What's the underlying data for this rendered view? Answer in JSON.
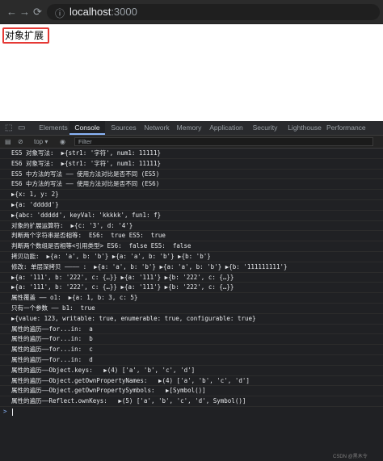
{
  "browser": {
    "back_icon": "←",
    "forward_icon": "→",
    "reload_icon": "⟳",
    "info_icon": "ⓘ",
    "url_host": "localhost",
    "url_port": ":3000"
  },
  "page": {
    "title": "对象扩展"
  },
  "devtools": {
    "tabs": [
      "Elements",
      "Console",
      "Sources",
      "Network",
      "Memory",
      "Application",
      "Security",
      "Lighthouse",
      "Performance"
    ],
    "active_tab": "Console",
    "context": "top ▾",
    "filter_placeholder": "Filter"
  },
  "console_lines": [
    "ES5 对象写法:  ▶{str1: '字符', num1: 11111}",
    "ES6 对象写法:  ▶{str1: '字符', num1: 11111}",
    "ES5 中方法的写法 —— 使用方法对比是否不同 (ES5)",
    "ES6 中方法的写法 —— 使用方法对比是否不同 (ES6)",
    "▶{x: 1, y: 2}",
    "▶{a: 'ddddd'}",
    "▶{abc: 'ddddd', keyVal: 'kkkkk', fun1: f}",
    "对象的扩展运算符:  ▶{c: '3', d: '4'}",
    "判断两个字符串是否相等:  ES6:  true ES5:  true",
    "判断两个数组是否相等<引用类型> ES6:  false ES5:  false",
    "拷贝功能:  ▶{a: 'a', b: 'b'} ▶{a: 'a', b: 'b'} ▶{b: 'b'}",
    "修改: 单层深拷贝 ———— :  ▶{a: 'a', b: 'b'} ▶{a: 'a', b: 'b'} ▶{b: '111111111'}",
    "▶{a: '111', b: '222', c: {…}} ▶{a: '111'} ▶{b: '222', c: {…}}",
    "▶{a: '111', b: '222', c: {…}} ▶{a: '111'} ▶{b: '222', c: {…}}",
    "属性覆盖 —— o1:  ▶{a: 1, b: 3, c: 5}",
    "只有一个参数 —— b1:  true",
    "▶{value: 123, writable: true, enumerable: true, configurable: true}",
    "属性的遍历——for...in:  a",
    "属性的遍历——for...in:  b",
    "属性的遍历——for...in:  c",
    "属性的遍历——for...in:  d",
    "属性的遍历——Object.keys:   ▶(4) ['a', 'b', 'c', 'd']",
    "属性的遍历——Object.getOwnPropertyNames:   ▶(4) ['a', 'b', 'c', 'd']",
    "属性的遍历——Object.getOwnPropertySymbols:   ▶[Symbol()]",
    "属性的遍历——Reflect.ownKeys:   ▶(5) ['a', 'b', 'c', 'd', Symbol()]"
  ],
  "prompt_symbol": ">",
  "watermark": "CSDN @黑木令"
}
